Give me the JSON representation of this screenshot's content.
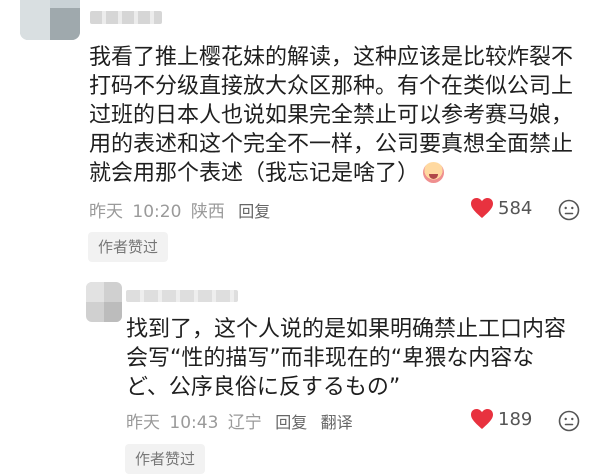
{
  "comments": [
    {
      "lines": [
        "我看了推上樱花妹的解读，这种应该是比较炸裂不",
        "打码不分级直接放大众区那种。有个在类似公司上",
        "过班的日本人也说如果完全禁止可以参考赛马娘，",
        "用的表述和这个完全不一样，公司要真想全面禁止",
        "就会用那个表述（我忘记是啥了）"
      ],
      "emoji": "crying-face-emoji",
      "date": "昨天",
      "time": "10:20",
      "location": "陕西",
      "reply_label": "回复",
      "likes": "584",
      "author_liked": "作者赞过"
    },
    {
      "lines": [
        "找到了，这个人说的是如果明确禁止工口内容",
        "会写“性的描写”而非现在的“卑猥な内容な",
        "ど、公序良俗に反するもの”"
      ],
      "date": "昨天",
      "time": "10:43",
      "location": "辽宁",
      "reply_label": "回复",
      "translate_label": "翻译",
      "likes": "189",
      "author_liked": "作者赞过"
    }
  ],
  "colors": {
    "like_heart": "#e8323f",
    "meta_text": "#9a9a9a",
    "tag_bg": "#f2f2f2"
  },
  "icons": {
    "like": "heart-icon",
    "dislike": "dislike-face-icon"
  }
}
